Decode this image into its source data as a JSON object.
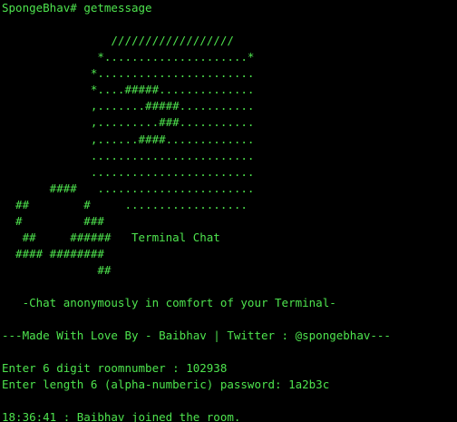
{
  "prompt": {
    "user_host": "SpongeBhav#",
    "command": "getmessage"
  },
  "ascii_art": [
    "                //////////////////",
    "              *.....................*",
    "             *.......................",
    "             *....#####..............",
    "             ,.......#####...........",
    "             ,.........###...........",
    "             ,......####.............",
    "             ........................",
    "             ........................",
    "       ####   .......................",
    "  ##        #     ..................",
    "  #         ###",
    "   ##     ######   Terminal Chat",
    "  #### ########",
    "              ##"
  ],
  "tagline": "   -Chat anonymously in comfort of your Terminal-",
  "credits": "---Made With Love By - Baibhav | Twitter : @spongebhav---",
  "room_prompt": {
    "label": "Enter 6 digit roomnumber : ",
    "value": "102938"
  },
  "password_prompt": {
    "label": "Enter length 6 (alpha-numberic) password: ",
    "value": "1a2b3c"
  },
  "status_message": "18:36:41 : Baibhav joined the room.",
  "colors": {
    "background": "#000000",
    "foreground": "#4ee44e"
  }
}
